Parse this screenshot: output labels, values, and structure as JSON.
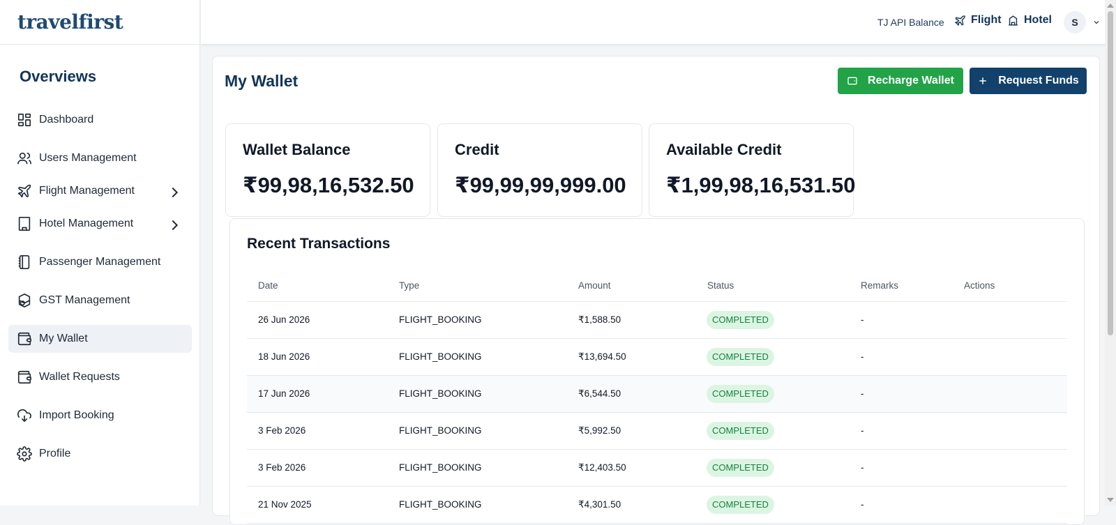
{
  "brand": {
    "logo": "travelfirst"
  },
  "sidebar": {
    "section_title": "Overviews",
    "items": [
      {
        "label": "Dashboard",
        "icon": "dashboard-icon"
      },
      {
        "label": "Users Management",
        "icon": "users-icon"
      },
      {
        "label": "Flight Management",
        "icon": "plane-icon",
        "has_submenu": true
      },
      {
        "label": "Hotel Management",
        "icon": "building-icon",
        "has_submenu": true
      },
      {
        "label": "Passenger Management",
        "icon": "passport-icon"
      },
      {
        "label": "GST Management",
        "icon": "gst-icon"
      },
      {
        "label": "My Wallet",
        "icon": "wallet-icon",
        "active": true
      },
      {
        "label": "Wallet Requests",
        "icon": "wallet-icon"
      },
      {
        "label": "Import Booking",
        "icon": "cloud-download-icon"
      },
      {
        "label": "Profile",
        "icon": "gear-icon"
      }
    ]
  },
  "header": {
    "api_balance": "TJ API Balance",
    "flight_link": "Flight",
    "hotel_link": "Hotel",
    "avatar_initial": "S"
  },
  "main": {
    "title": "My Wallet",
    "recharge_button": "Recharge Wallet",
    "request_button": "Request Funds",
    "stats": [
      {
        "label": "Wallet Balance",
        "value": "₹99,98,16,532.50"
      },
      {
        "label": "Credit",
        "value": "₹99,99,99,999.00"
      },
      {
        "label": "Available Credit",
        "value": "₹1,99,98,16,531.50"
      }
    ],
    "transactions": {
      "title": "Recent Transactions",
      "columns": [
        "Date",
        "Type",
        "Amount",
        "Status",
        "Remarks",
        "Actions"
      ],
      "rows": [
        {
          "date": "26 Jun 2026",
          "type": "FLIGHT_BOOKING",
          "amount": "₹1,588.50",
          "status": "COMPLETED",
          "remarks": "-"
        },
        {
          "date": "18 Jun 2026",
          "type": "FLIGHT_BOOKING",
          "amount": "₹13,694.50",
          "status": "COMPLETED",
          "remarks": "-"
        },
        {
          "date": "17 Jun 2026",
          "type": "FLIGHT_BOOKING",
          "amount": "₹6,544.50",
          "status": "COMPLETED",
          "remarks": "-"
        },
        {
          "date": "3 Feb 2026",
          "type": "FLIGHT_BOOKING",
          "amount": "₹5,992.50",
          "status": "COMPLETED",
          "remarks": "-"
        },
        {
          "date": "3 Feb 2026",
          "type": "FLIGHT_BOOKING",
          "amount": "₹12,403.50",
          "status": "COMPLETED",
          "remarks": "-"
        },
        {
          "date": "21 Nov 2025",
          "type": "FLIGHT_BOOKING",
          "amount": "₹4,301.50",
          "status": "COMPLETED",
          "remarks": "-"
        }
      ]
    }
  },
  "colors": {
    "brand_navy": "#12345a",
    "recharge_green": "#22a348",
    "request_blue": "#12416b",
    "badge_bg": "#dcf5e3",
    "badge_text": "#15803d"
  }
}
